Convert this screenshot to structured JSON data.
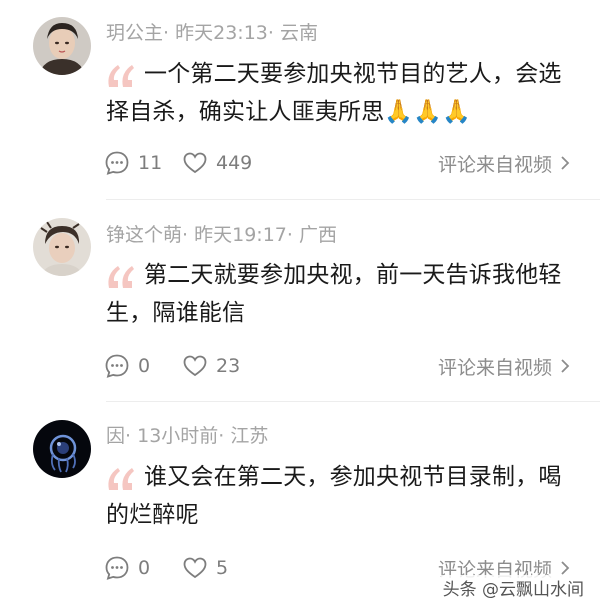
{
  "comments": [
    {
      "username": "玥公主",
      "time": "昨天23:13",
      "location": "云南",
      "text": "一个第二天要参加央视节目的艺人，会选择自杀，确实让人匪夷所思🙏🙏🙏",
      "reply_count": "11",
      "like_count": "449",
      "source_label": "评论来自视频"
    },
    {
      "username": "铮这个萌",
      "time": "昨天19:17",
      "location": "广西",
      "text": "第二天就要参加央视，前一天告诉我他轻生，隔谁能信",
      "reply_count": "0",
      "like_count": "23",
      "source_label": "评论来自视频"
    },
    {
      "username": "因",
      "time": "13小时前",
      "location": "江苏",
      "text": "谁又会在第二天，参加央视节目录制，喝的烂醉呢",
      "reply_count": "0",
      "like_count": "5",
      "source_label": "评论来自视频"
    }
  ],
  "meta_separator": "·",
  "watermark": "头条 @云飘山水间",
  "colors": {
    "meta": "#a4a4a4",
    "quote": "#f5c6c1",
    "body": "#1a1a1a",
    "action": "#7d7d7d"
  },
  "icons": {
    "quote": "quote-icon",
    "reply": "comment-bubble-icon",
    "like": "heart-icon",
    "more": "chevron-right-icon"
  }
}
